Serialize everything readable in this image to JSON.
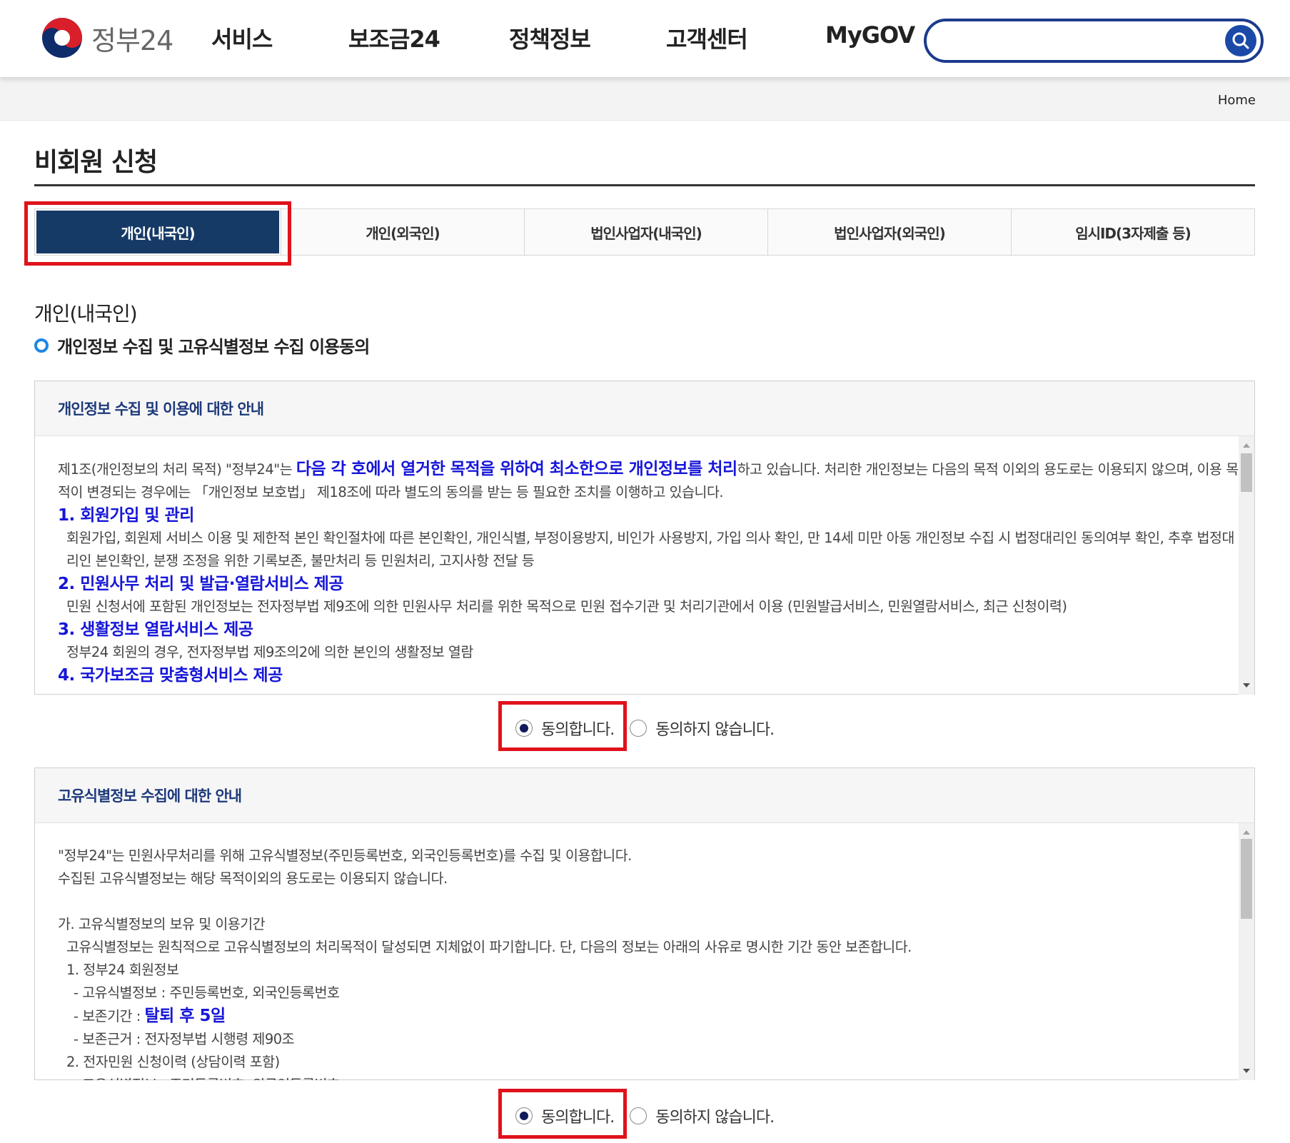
{
  "header": {
    "logo_text": "정부24",
    "nav": [
      "서비스",
      "보조금24",
      "정책정보",
      "고객센터",
      "MyGOV"
    ],
    "search_value": ""
  },
  "breadcrumb": {
    "home": "Home"
  },
  "page": {
    "title": "비회원 신청"
  },
  "tabs": [
    "개인(내국인)",
    "개인(외국인)",
    "법인사업자(내국인)",
    "법인사업자(외국인)",
    "임시ID(3자제출 등)"
  ],
  "section": {
    "title": "개인(내국인)",
    "subtitle": "개인정보 수집 및 고유식별정보 수집 이용동의"
  },
  "privacy_box": {
    "heading": "개인정보 수집 및 이용에 대한 안내",
    "intro_part1": "제1조(개인정보의 처리 목적) \"정부24\"는 ",
    "intro_emph": "다음 각 호에서 열거한 목적을 위하여 최소한으로 개인정보를 처리",
    "intro_part2": "하고 있습니다. 처리한 개인정보는 다음의 목적 이외의 용도로는 이용되지 않으며, 이용 목적이 변경되는 경우에는 「개인정보 보호법」 제18조에 따라 별도의 동의를 받는 등 필요한 조치를 이행하고 있습니다.",
    "items": [
      {
        "title": "1. 회원가입 및 관리",
        "desc": "회원가입, 회원제 서비스 이용 및 제한적 본인 확인절차에 따른 본인확인, 개인식별, 부정이용방지, 비인가 사용방지, 가입 의사 확인, 만 14세 미만 아동 개인정보 수집 시 법정대리인 동의여부 확인, 추후 법정대리인 본인확인, 분쟁 조정을 위한 기록보존, 불만처리 등 민원처리, 고지사항 전달 등"
      },
      {
        "title": "2. 민원사무 처리 및 발급·열람서비스 제공",
        "desc": "민원 신청서에 포함된 개인정보는 전자정부법 제9조에 의한 민원사무 처리를 위한 목적으로 민원 접수기관 및 처리기관에서 이용 (민원발급서비스, 민원열람서비스, 최근 신청이력)"
      },
      {
        "title": "3. 생활정보 열람서비스 제공",
        "desc": "정부24 회원의 경우, 전자정부법 제9조의2에 의한 본인의 생활정보 열람"
      },
      {
        "title": "4. 국가보조금 맞춤형서비스 제공",
        "desc": ""
      }
    ],
    "agree_label": "동의합니다.",
    "disagree_label": "동의하지 않습니다."
  },
  "unique_id_box": {
    "heading": "고유식별정보 수집에 대한 안내",
    "line1": "\"정부24\"는 민원사무처리를 위해 고유식별정보(주민등록번호, 외국인등록번호)를 수집 및 이용합니다.",
    "line2": "수집된 고유식별정보는 해당 목적이외의 용도로는 이용되지 않습니다.",
    "ga_title": "가. 고유식별정보의 보유 및 이용기간",
    "ga_desc": "고유식별정보는 원칙적으로 고유식별정보의 처리목적이 달성되면 지체없이 파기합니다. 단, 다음의 정보는 아래의 사유로 명시한 기간 동안 보존합니다.",
    "sub1_title": "1. 정부24 회원정보",
    "sub1_a": "- 고유식별정보 : 주민등록번호, 외국인등록번호",
    "sub1_b_label": "- 보존기간 : ",
    "sub1_b_emph": "탈퇴 후 5일",
    "sub1_c": "- 보존근거 : 전자정부법 시행령 제90조",
    "sub2_title": "2. 전자민원 신청이력 (상담이력 포함)",
    "sub2_a": "- 고유식별정보 : 주민등록번호, 외국인등록번호",
    "agree_label": "동의합니다.",
    "disagree_label": "동의하지 않습니다."
  },
  "colors": {
    "accent_navy": "#163a66",
    "highlight_red": "#e0121b",
    "link_blue": "#1616d8",
    "search_border": "#1b3b8c"
  }
}
